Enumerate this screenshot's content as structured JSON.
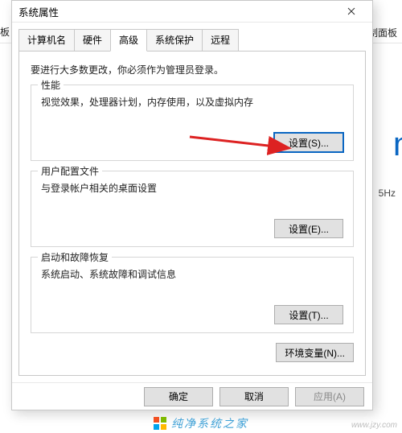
{
  "backdrop": {
    "breadcrumb_left": "板",
    "control_panel": "索控制面板",
    "windows_fragment": "ndo",
    "ghz": "5Hz"
  },
  "dialog": {
    "title": "系统属性"
  },
  "tabs": {
    "computer_name": "计算机名",
    "hardware": "硬件",
    "advanced": "高级",
    "system_protection": "系统保护",
    "remote": "远程"
  },
  "panel": {
    "admin_note": "要进行大多数更改，你必须作为管理员登录。"
  },
  "performance": {
    "title": "性能",
    "desc": "视觉效果，处理器计划，内存使用，以及虚拟内存",
    "settings": "设置(S)..."
  },
  "user_profiles": {
    "title": "用户配置文件",
    "desc": "与登录帐户相关的桌面设置",
    "settings": "设置(E)..."
  },
  "startup": {
    "title": "启动和故障恢复",
    "desc": "系统启动、系统故障和调试信息",
    "settings": "设置(T)..."
  },
  "env_vars": {
    "label": "环境变量(N)..."
  },
  "footer": {
    "ok": "确定",
    "cancel": "取消",
    "apply": "应用(A)"
  },
  "watermark": {
    "text": "纯净系统之家",
    "url": "www.jzy.com"
  }
}
